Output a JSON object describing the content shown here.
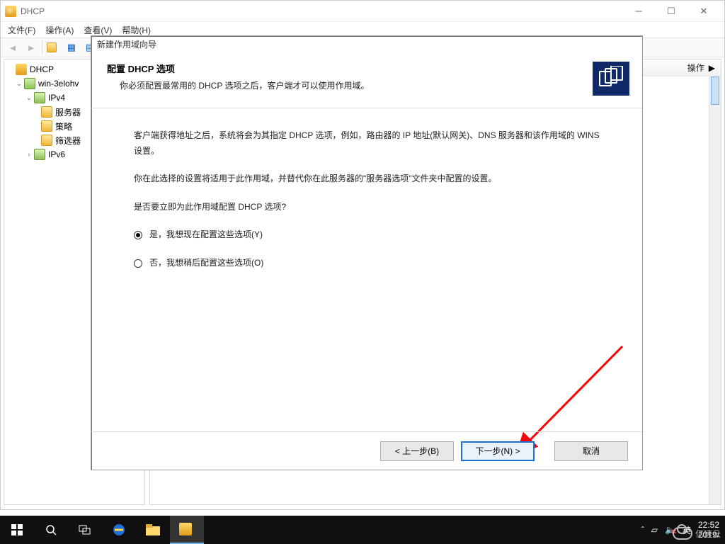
{
  "app": {
    "title": "DHCP"
  },
  "menubar": {
    "file": "文件(F)",
    "action": "操作(A)",
    "view": "查看(V)",
    "help": "帮助(H)"
  },
  "tree": {
    "root": "DHCP",
    "server": "win-3elohv",
    "ipv4": "IPv4",
    "ipv4_children": {
      "server_opts": "服务器",
      "policies": "策略",
      "filters": "筛选器"
    },
    "ipv6": "IPv6"
  },
  "content": {
    "header_right": "操作"
  },
  "wizard": {
    "title": "新建作用域向导",
    "header_title": "配置 DHCP 选项",
    "header_sub": "你必须配置最常用的 DHCP 选项之后，客户端才可以使用作用域。",
    "para1": "客户端获得地址之后，系统将会为其指定 DHCP 选项，例如，路由器的 IP 地址(默认网关)、DNS 服务器和该作用域的 WINS 设置。",
    "para2": "你在此选择的设置将适用于此作用域，并替代你在此服务器的\"服务器选项\"文件夹中配置的设置。",
    "question": "是否要立即为此作用域配置 DHCP 选项?",
    "opt_yes": "是，我想现在配置这些选项(Y)",
    "opt_no": "否，我想稍后配置这些选项(O)",
    "selected": "yes",
    "btn_back": "< 上一步(B)",
    "btn_next": "下一步(N) >",
    "btn_cancel": "取消"
  },
  "taskbar": {
    "ime": "英",
    "time": "22:52",
    "date": "2019/"
  },
  "watermark": "亿速云"
}
